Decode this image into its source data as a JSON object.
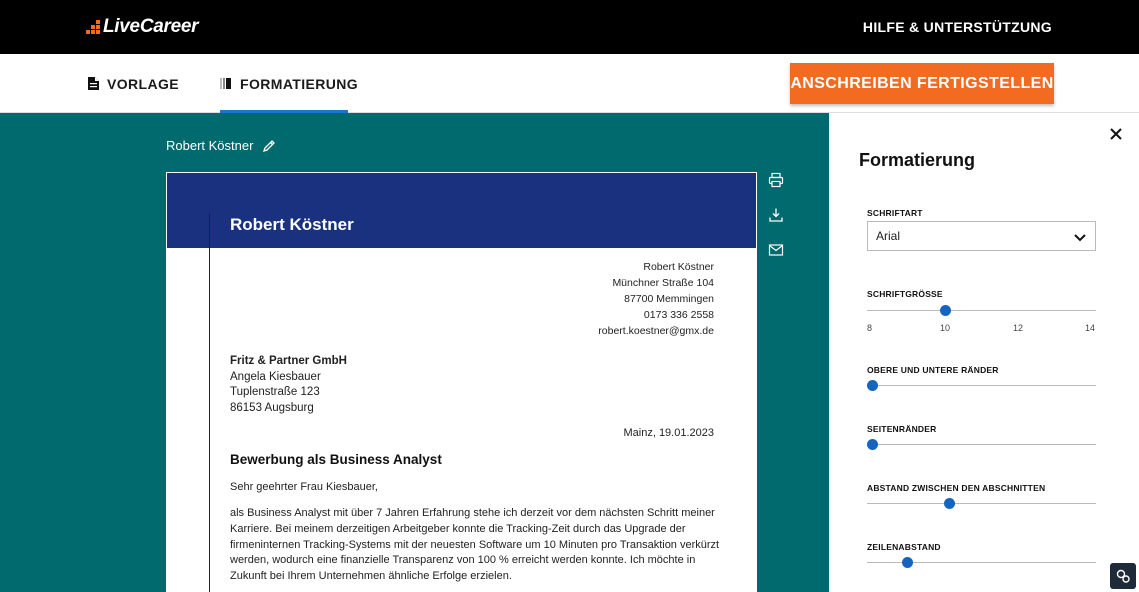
{
  "header": {
    "logo_text": "LiveCareer",
    "help_link": "HILFE & UNTERSTÜTZUNG"
  },
  "tabs": [
    {
      "label": "VORLAGE",
      "icon": "document-icon",
      "active": false
    },
    {
      "label": "FORMATIERUNG",
      "icon": "format-icon",
      "active": true
    }
  ],
  "finish_button": "ANSCHREIBEN FERTIGSTELLEN",
  "document": {
    "title": "Robert Köstner",
    "header_name": "Robert Köstner",
    "sender": {
      "name": "Robert Köstner",
      "street": "Münchner Straße 104",
      "city": "87700 Memmingen",
      "phone": "0173 336 2558",
      "email": "robert.koestner@gmx.de"
    },
    "recipient": {
      "company": "Fritz & Partner GmbH",
      "person": "Angela Kiesbauer",
      "street": "Tuplenstraße 123",
      "city": "86153 Augsburg"
    },
    "date": "Mainz, 19.01.2023",
    "subject": "Bewerbung als Business Analyst",
    "salutation": "Sehr geehrter Frau Kiesbauer,",
    "paragraph": "als Business Analyst mit über 7 Jahren Erfahrung stehe ich derzeit vor dem nächsten Schritt meiner Karriere. Bei meinem derzeitigen Arbeitgeber konnte die Tracking-Zeit durch das Upgrade der firmeninternen Tracking-Systems mit der neuesten Software um 10 Minuten pro Transaktion verkürzt werden, wodurch eine finanzielle Transparenz von 100 % erreicht werden konnte. Ich möchte in Zukunft bei Ihrem Unternehmen ähnliche Erfolge erzielen."
  },
  "side_actions": [
    "print-icon",
    "download-icon",
    "email-icon"
  ],
  "panel": {
    "title": "Formatierung",
    "font_label": "SCHRIFTART",
    "font_value": "Arial",
    "size_label": "SCHRIFTGRÖSSE",
    "size_value": 10,
    "size_ticks": [
      "8",
      "10",
      "12",
      "14"
    ],
    "margins_tb_label": "OBERE UND UNTERE RÄNDER",
    "margins_tb_value": 0,
    "margins_side_label": "SEITENRÄNDER",
    "margins_side_value": 0,
    "section_spacing_label": "ABSTAND ZWISCHEN DEN ABSCHNITTEN",
    "section_spacing_value": 0.35,
    "line_spacing_label": "ZEILENABSTAND",
    "line_spacing_value": 0.16
  },
  "colors": {
    "accent_orange": "#f26b21",
    "teal": "#006a6e",
    "doc_header_blue": "#1a3180",
    "slider_blue": "#1565c0"
  }
}
